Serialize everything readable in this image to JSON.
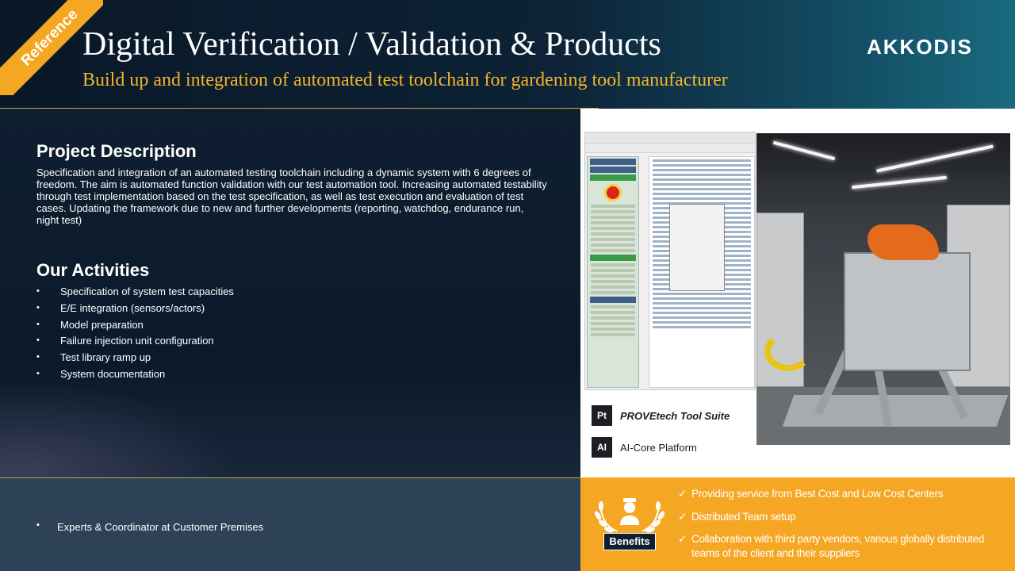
{
  "header": {
    "title": "Digital Verification / Validation & Products",
    "subtitle": "Build up and integration of automated test toolchain for gardening tool manufacturer",
    "corner_badge": "Reference",
    "logo": "AKKODIS"
  },
  "project_description": {
    "heading": "Project Description",
    "text": "Specification and integration of an automated testing toolchain including a dynamic system with 6 degrees of freedom. The aim is automated function validation with our test automation tool. Increasing automated testability through test implementation based on the test specification, as well as test execution and evaluation of test cases. Updating the framework due to new and further developments (reporting, watchdog, endurance run, night test)"
  },
  "activities": {
    "heading": "Our Activities",
    "items": [
      "Specification of system test capacities",
      "E/E integration (sensors/actors)",
      "Model preparation",
      "Failure injection unit configuration",
      "Test library ramp up",
      "System documentation"
    ]
  },
  "engagement": {
    "item": "Experts & Coordinator at Customer Premises"
  },
  "tools": [
    {
      "icon": "Pt",
      "label": "PROVEtech Tool Suite"
    },
    {
      "icon": "AI",
      "label": "AI-Core Platform"
    }
  ],
  "benefits": {
    "label": "Benefits",
    "items": [
      "Providing service from Best Cost and Low Cost Centers",
      "Distributed Team setup",
      "Collaboration with third party vendors, various globally distributed teams of the client and their suppliers"
    ]
  },
  "colors": {
    "accent_orange": "#f5a623",
    "subtitle_gold": "#f1b52c",
    "navy": "#0e1f31",
    "bottom_panel": "#2d4257"
  }
}
